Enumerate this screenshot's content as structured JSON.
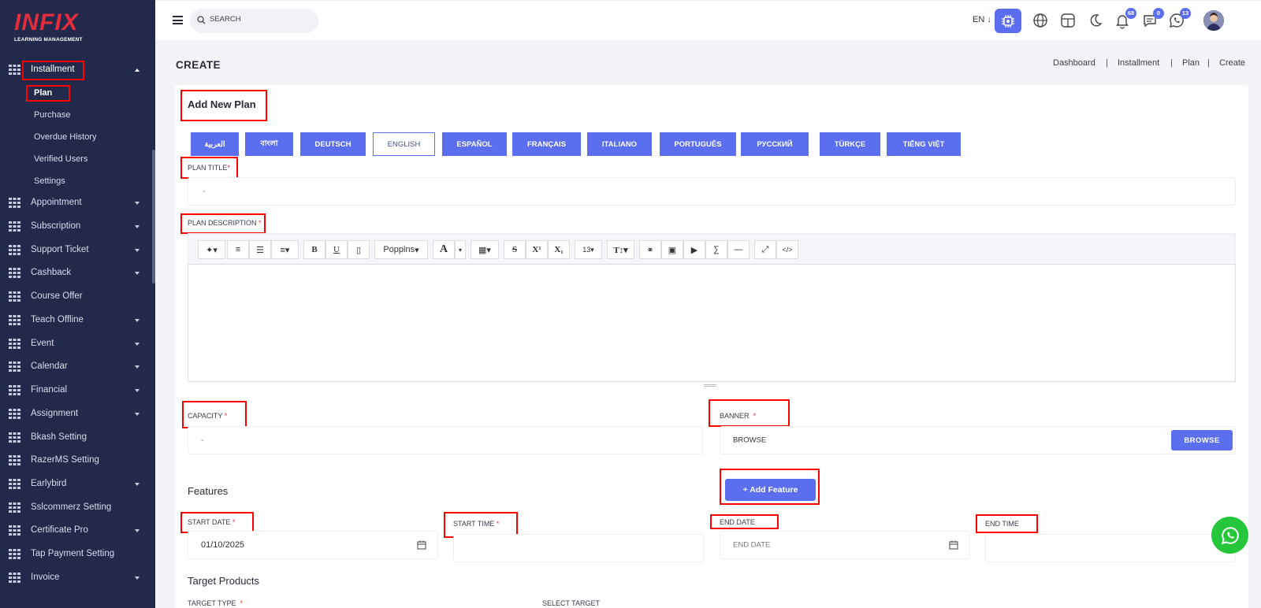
{
  "brand": {
    "logo": "INFIX",
    "tagline": "LEARNING MANAGEMENT"
  },
  "sidebar": {
    "open_group": "Installment",
    "sub_items": [
      "Plan",
      "Purchase",
      "Overdue History",
      "Verified Users",
      "Settings"
    ],
    "items": [
      {
        "label": "Appointment",
        "chevron": true
      },
      {
        "label": "Subscription",
        "chevron": true
      },
      {
        "label": "Support Ticket",
        "chevron": true
      },
      {
        "label": "Cashback",
        "chevron": true
      },
      {
        "label": "Course Offer",
        "chevron": false
      },
      {
        "label": "Teach Offline",
        "chevron": true
      },
      {
        "label": "Event",
        "chevron": true
      },
      {
        "label": "Calendar",
        "chevron": true
      },
      {
        "label": "Financial",
        "chevron": true
      },
      {
        "label": "Assignment",
        "chevron": true
      },
      {
        "label": "Bkash Setting",
        "chevron": false
      },
      {
        "label": "RazerMS Setting",
        "chevron": false
      },
      {
        "label": "Earlybird",
        "chevron": true
      },
      {
        "label": "Sslcommerz Setting",
        "chevron": false
      },
      {
        "label": "Certificate Pro",
        "chevron": true
      },
      {
        "label": "Tap Payment Setting",
        "chevron": false
      },
      {
        "label": "Invoice",
        "chevron": true
      }
    ]
  },
  "topbar": {
    "search_placeholder": "SEARCH",
    "language": "EN",
    "badges": {
      "notifications": "68",
      "messages": "0",
      "whatsapp": "13"
    }
  },
  "page": {
    "title": "CREATE",
    "breadcrumb": [
      "Dashboard",
      "Installment",
      "Plan",
      "Create"
    ]
  },
  "form": {
    "heading": "Add New Plan",
    "languages": [
      "العربية",
      "বাংলা",
      "DEUTSCH",
      "ENGLISH",
      "ESPAÑOL",
      "FRANÇAIS",
      "ITALIANO",
      "PORTUGUÊS",
      "РУССКИЙ",
      "TÜRKÇE",
      "TIẾNG VIỆT"
    ],
    "active_language": "ENGLISH",
    "plan_title": {
      "label": "PLAN TITLE",
      "value": "-"
    },
    "plan_description": {
      "label": "PLAN DESCRIPTION",
      "font": "Poppins",
      "font_size": "13"
    },
    "capacity": {
      "label": "CAPACITY",
      "value": "-"
    },
    "banner": {
      "label": "BANNER",
      "value": "BROWSE",
      "button": "BROWSE"
    },
    "features": {
      "heading": "Features",
      "add_button": "+ Add Feature"
    },
    "start_date": {
      "label": "START DATE",
      "value": "01/10/2025"
    },
    "start_time": {
      "label": "START TIME",
      "value": ""
    },
    "end_date": {
      "label": "END DATE",
      "placeholder": "END DATE"
    },
    "end_time": {
      "label": "END TIME",
      "value": ""
    },
    "target_products": {
      "heading": "Target Products",
      "target_type_label": "TARGET TYPE",
      "select_target_label": "SELECT TARGET"
    }
  },
  "colors": {
    "sidebar": "#23294a",
    "accent": "#5b6ef0",
    "highlight": "#ff0000",
    "whatsapp": "#25c63a"
  }
}
